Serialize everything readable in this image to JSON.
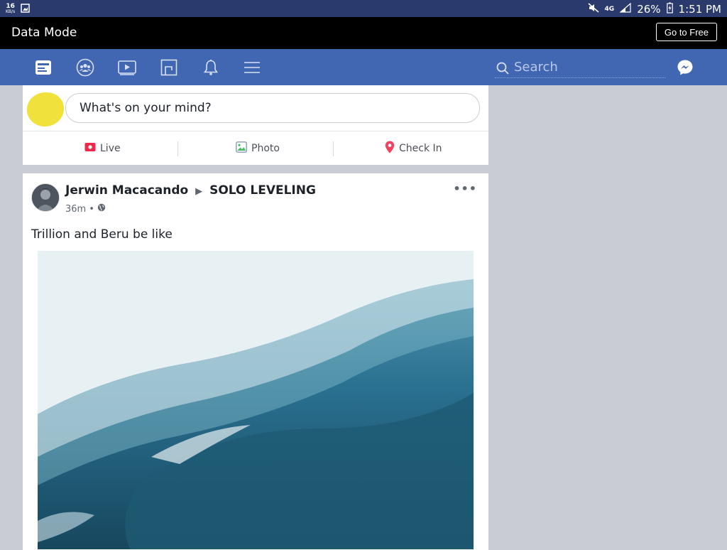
{
  "status_bar": {
    "net_speed": "16",
    "net_unit": "KB/s",
    "network": "4G",
    "battery": "26%",
    "time": "1:51 PM"
  },
  "data_mode": {
    "label": "Data Mode",
    "button": "Go to Free"
  },
  "nav": {
    "icons": [
      "news-feed-icon",
      "groups-icon",
      "watch-icon",
      "marketplace-icon",
      "notifications-icon",
      "menu-icon"
    ],
    "search_placeholder": "Search"
  },
  "composer": {
    "placeholder": "What's on your mind?",
    "actions": [
      {
        "label": "Live",
        "icon": "live-icon",
        "color": "#f02849"
      },
      {
        "label": "Photo",
        "icon": "photo-icon",
        "color": "#45bd62"
      },
      {
        "label": "Check In",
        "icon": "location-pin-icon",
        "color": "#f3425f"
      }
    ]
  },
  "post": {
    "author": "Jerwin Macacando",
    "group": "SOLO LEVELING",
    "time": "36m",
    "separator": "•",
    "text": "Trillion and Beru be like"
  },
  "colors": {
    "navbar": "#4267b2",
    "background": "#c9ccd3",
    "data_mode_bar": "#000000"
  }
}
